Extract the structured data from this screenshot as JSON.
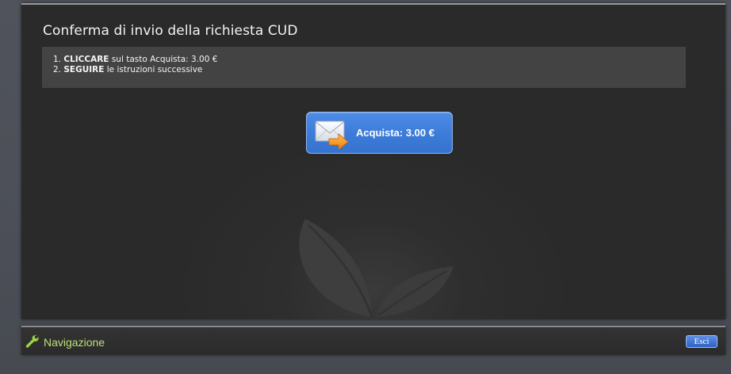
{
  "page": {
    "title": "Conferma di invio della richiesta CUD"
  },
  "steps": [
    {
      "number": "1.",
      "bold": "CLICCARE",
      "text": " sul tasto Acquista: 3.00 €"
    },
    {
      "number": "2.",
      "bold": "SEGUIRE",
      "text": " le istruzioni successive"
    }
  ],
  "buy_button": {
    "label": "Acquista: 3.00 €",
    "icon": "mail-send-icon"
  },
  "navigation": {
    "title": "Navigazione",
    "icon": "wrench-icon",
    "exit_label": "Esci"
  },
  "colors": {
    "panel": "#2e2e2e",
    "page_background": "#4c4f57",
    "accent_blue": "#3c7bd8",
    "nav_title": "#bce07a"
  }
}
